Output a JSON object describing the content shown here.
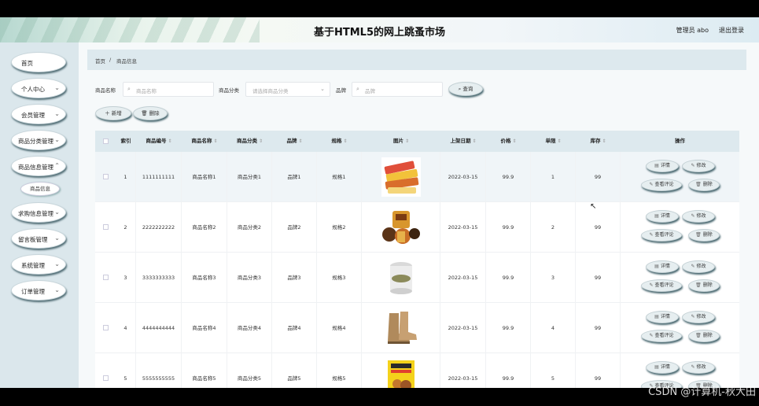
{
  "header": {
    "title": "基于HTML5的网上跳蚤市场",
    "user": "管理员 abo",
    "logout": "退出登录"
  },
  "sidebar": {
    "items": [
      {
        "label": "首页",
        "chevron": false
      },
      {
        "label": "个人中心",
        "chevron": true
      },
      {
        "label": "会员管理",
        "chevron": true
      },
      {
        "label": "商品分类管理",
        "chevron": true
      },
      {
        "label": "商品信息管理",
        "chevron": true
      },
      {
        "label": "求购信息管理",
        "chevron": true
      },
      {
        "label": "留言板管理",
        "chevron": true
      },
      {
        "label": "系统管理",
        "chevron": true
      },
      {
        "label": "订单管理",
        "chevron": true
      }
    ],
    "sub_item": "商品信息"
  },
  "breadcrumb": {
    "home": "首页",
    "separator": "/",
    "current": "商品信息"
  },
  "search": {
    "name_label": "商品名称",
    "name_placeholder": "商品名称",
    "category_label": "商品分类",
    "category_placeholder": "请选择商品分类",
    "brand_label": "品牌",
    "brand_placeholder": "品牌",
    "query_button": "查询"
  },
  "actions": {
    "add": "新增",
    "delete": "删除"
  },
  "table": {
    "headers": {
      "index": "索引",
      "code": "商品编号",
      "name": "商品名称",
      "category": "商品分类",
      "brand": "品牌",
      "spec": "规格",
      "image": "图片",
      "date": "上架日期",
      "price": "价格",
      "limit": "单限",
      "stock": "库存",
      "ops": "操作"
    },
    "row_actions": {
      "detail": "详情",
      "edit": "修改",
      "review": "查看评论",
      "delete": "删除"
    },
    "rows": [
      {
        "index": "1",
        "code": "1111111111",
        "name": "商品名称1",
        "category": "商品分类1",
        "brand": "品牌1",
        "spec": "规格1",
        "date": "2022-03-15",
        "price": "99.9",
        "limit": "1",
        "stock": "99",
        "image": "candy"
      },
      {
        "index": "2",
        "code": "2222222222",
        "name": "商品名称2",
        "category": "商品分类2",
        "brand": "品牌2",
        "spec": "规格2",
        "date": "2022-03-15",
        "price": "99.9",
        "limit": "2",
        "stock": "99",
        "image": "snacks"
      },
      {
        "index": "3",
        "code": "3333333333",
        "name": "商品名称3",
        "category": "商品分类3",
        "brand": "品牌3",
        "spec": "规格3",
        "date": "2022-03-15",
        "price": "99.9",
        "limit": "3",
        "stock": "99",
        "image": "cup"
      },
      {
        "index": "4",
        "code": "4444444444",
        "name": "商品名称4",
        "category": "商品分类4",
        "brand": "品牌4",
        "spec": "规格4",
        "date": "2022-03-15",
        "price": "99.9",
        "limit": "4",
        "stock": "99",
        "image": "boots"
      },
      {
        "index": "5",
        "code": "5555555555",
        "name": "商品名称5",
        "category": "商品分类5",
        "brand": "品牌5",
        "spec": "规格5",
        "date": "2022-03-15",
        "price": "99.9",
        "limit": "5",
        "stock": "99",
        "image": "book"
      }
    ]
  },
  "watermark": "CSDN @计算机-秋大田"
}
